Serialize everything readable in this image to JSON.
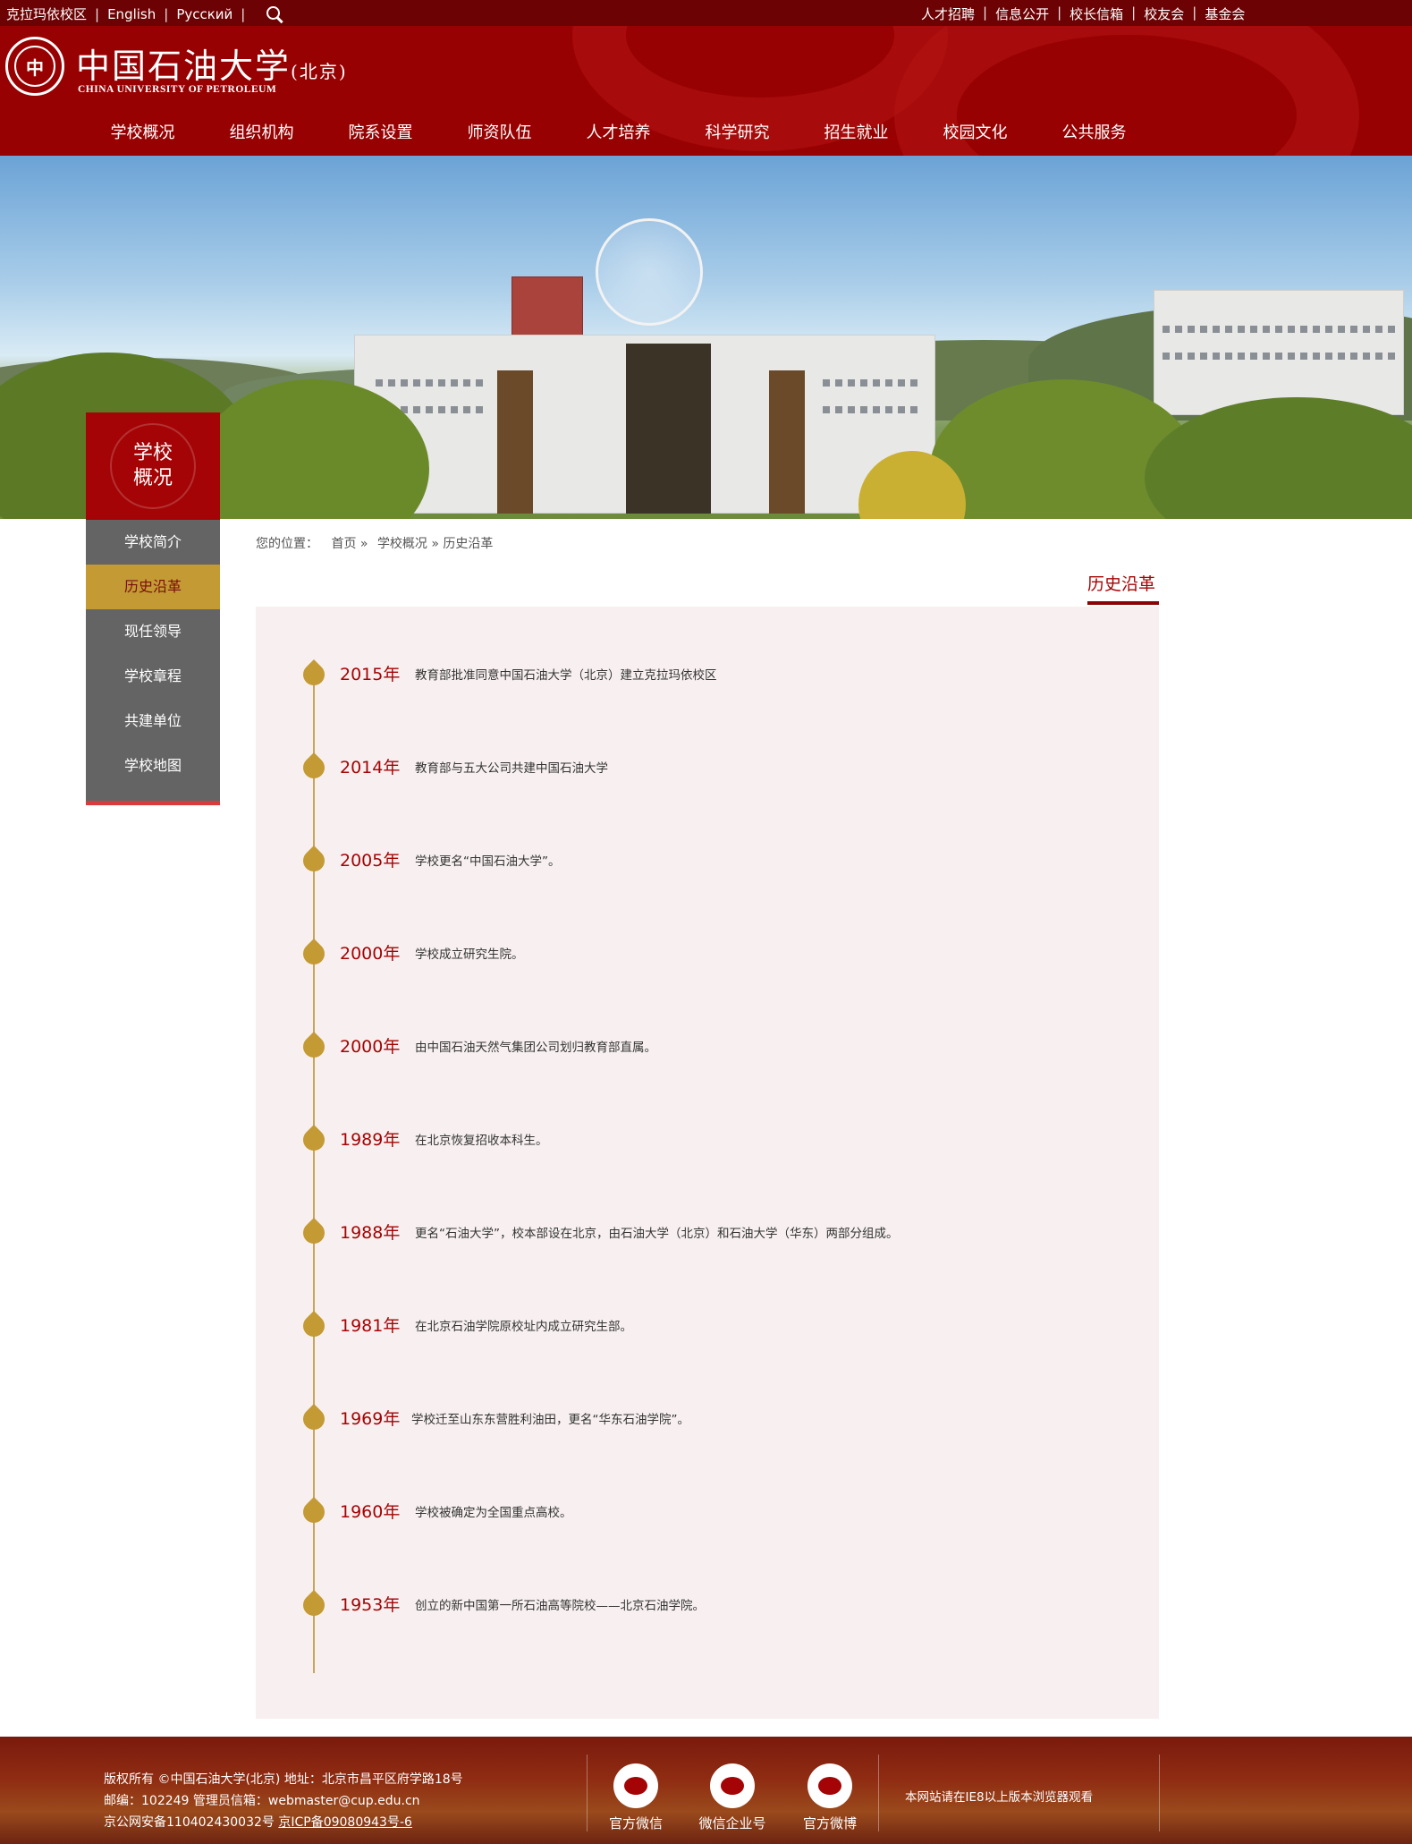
{
  "topbar": {
    "left_links": [
      "克拉玛依校区",
      "English",
      "Русский"
    ],
    "right_links": [
      "人才招聘",
      "信息公开",
      "校长信箱",
      "校友会",
      "基金会"
    ]
  },
  "header": {
    "emblem_text": "中",
    "logo_cn": "中国石油大学",
    "logo_cn_suffix": "(北京)",
    "logo_en": "CHINA UNIVERSITY OF PETROLEUM",
    "nav": [
      "学校概况",
      "组织机构",
      "院系设置",
      "师资队伍",
      "人才培养",
      "科学研究",
      "招生就业",
      "校园文化",
      "公共服务"
    ]
  },
  "side": {
    "title_line1": "学校",
    "title_line2": "概况",
    "menu": [
      "学校简介",
      "历史沿革",
      "现任领导",
      "学校章程",
      "共建单位",
      "学校地图"
    ],
    "active_index": 1
  },
  "breadcrumb": {
    "prefix": "您的位置：",
    "home": "首页",
    "sep": "»",
    "section": "学校概况",
    "current": "历史沿革"
  },
  "page_title": "历史沿革",
  "timeline": [
    {
      "year": "2015年",
      "text": "教育部批准同意中国石油大学（北京）建立克拉玛依校区"
    },
    {
      "year": "2014年",
      "text": "教育部与五大公司共建中国石油大学"
    },
    {
      "year": "2005年",
      "text": "学校更名“中国石油大学”。"
    },
    {
      "year": "2000年",
      "text": "学校成立研究生院。"
    },
    {
      "year": "2000年",
      "text": "由中国石油天然气集团公司划归教育部直属。"
    },
    {
      "year": "1989年",
      "text": "在北京恢复招收本科生。"
    },
    {
      "year": "1988年",
      "text": "更名“石油大学”，校本部设在北京，由石油大学（北京）和石油大学（华东）两部分组成。"
    },
    {
      "year": "1981年",
      "text": "在北京石油学院原校址内成立研究生部。"
    },
    {
      "year": "1969年",
      "text": "学校迁至山东东营胜利油田，更名“华东石油学院”。"
    },
    {
      "year": "1960年",
      "text": "学校被确定为全国重点高校。"
    },
    {
      "year": "1953年",
      "text": "创立的新中国第一所石油高等院校——北京石油学院。"
    }
  ],
  "footer": {
    "line1": "版权所有 ©中国石油大学(北京)  地址：北京市昌平区府学路18号",
    "line2": "邮编：102249  管理员信箱：webmaster@cup.edu.cn",
    "line3_prefix": "京公网安备110402430032号",
    "line3_link": "京ICP备09080943号-6",
    "qr": [
      "官方微信",
      "微信企业号",
      "官方微博"
    ],
    "note": "本网站请在IE8以上版本浏览器观看"
  },
  "colors": {
    "brand_red": "#970102",
    "dark_red": "#6c0203",
    "gold": "#c39a34",
    "menu_gray": "#646464"
  }
}
